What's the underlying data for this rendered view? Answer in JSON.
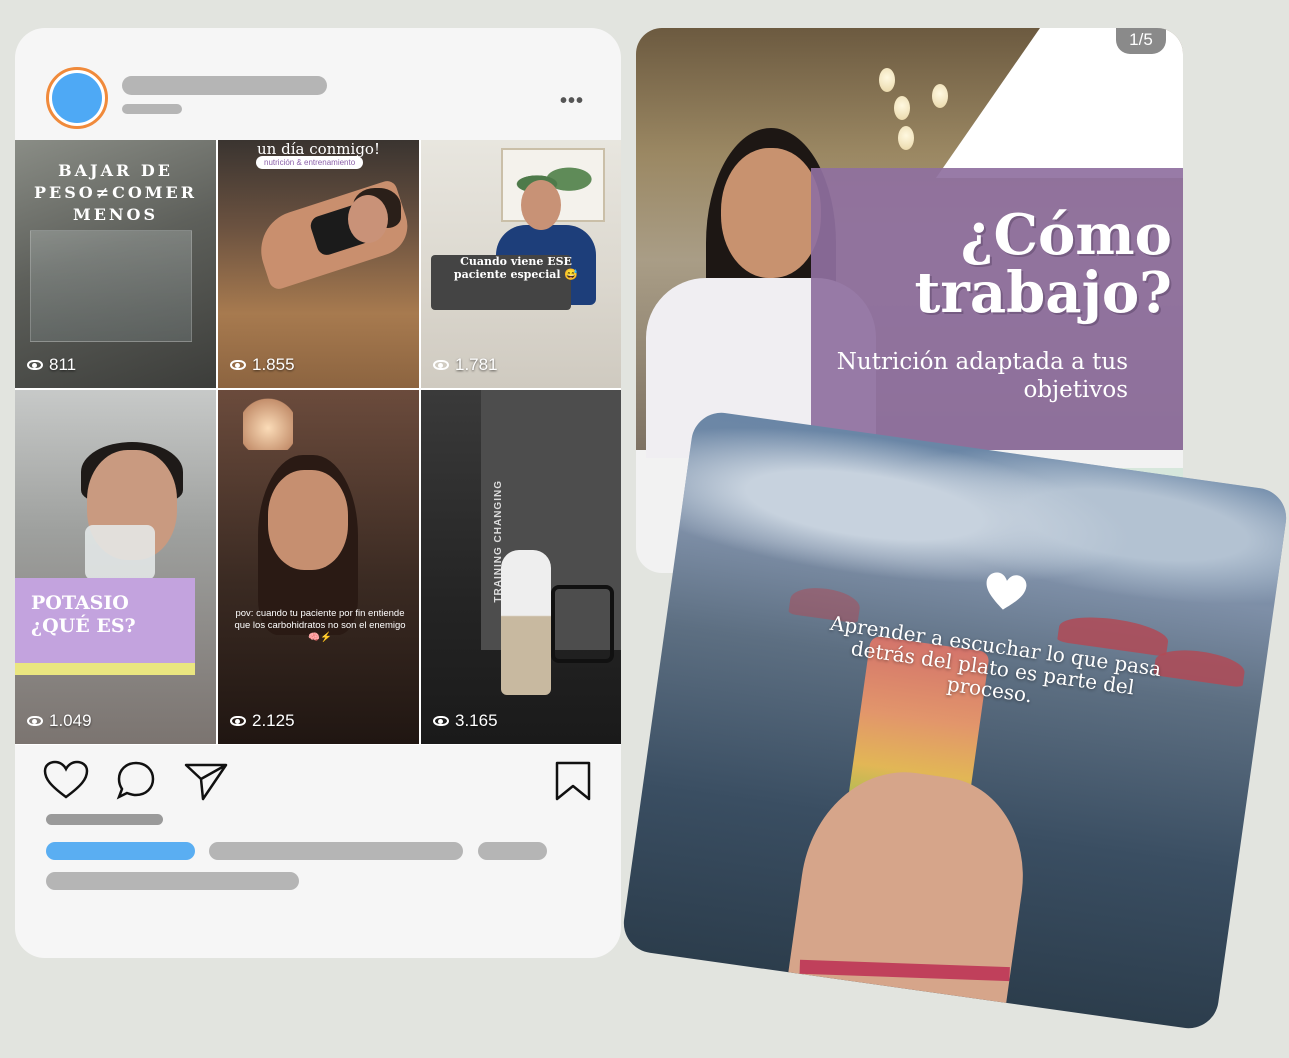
{
  "profile_card": {
    "more_label": "•••",
    "tiles": [
      {
        "id": "t1",
        "text": "BAJAR DE PESO≠COMER MENOS",
        "views": "811"
      },
      {
        "id": "t2",
        "text": "un día conmigo!",
        "tag": "nutrición & entrenamiento",
        "views": "1.855"
      },
      {
        "id": "t3",
        "text": "Cuando viene ESE paciente especial 😅",
        "views": "1.781"
      },
      {
        "id": "t4",
        "text": "POTASIO ¿QUÉ ES?",
        "views": "1.049"
      },
      {
        "id": "t5",
        "text": "pov: cuando tu paciente por fin entiende que los carbohidratos no son el enemigo 🧠⚡",
        "views": "2.125"
      },
      {
        "id": "t6",
        "text": "TRAINING CHANGING",
        "views": "3.165"
      }
    ]
  },
  "post2": {
    "counter": "1/5",
    "title": "¿Cómo trabajo?",
    "subtitle": "Nutrición adaptada a tus objetivos"
  },
  "post3": {
    "quote": "Aprender a escuchar lo que pasa detrás del plato es parte del proceso."
  },
  "colors": {
    "background": "#e2e4df",
    "avatar_ring": "#f08a3b",
    "avatar_fill": "#4ea9f5",
    "link_bar": "#5aaef2",
    "purple": "#8f70a0"
  }
}
